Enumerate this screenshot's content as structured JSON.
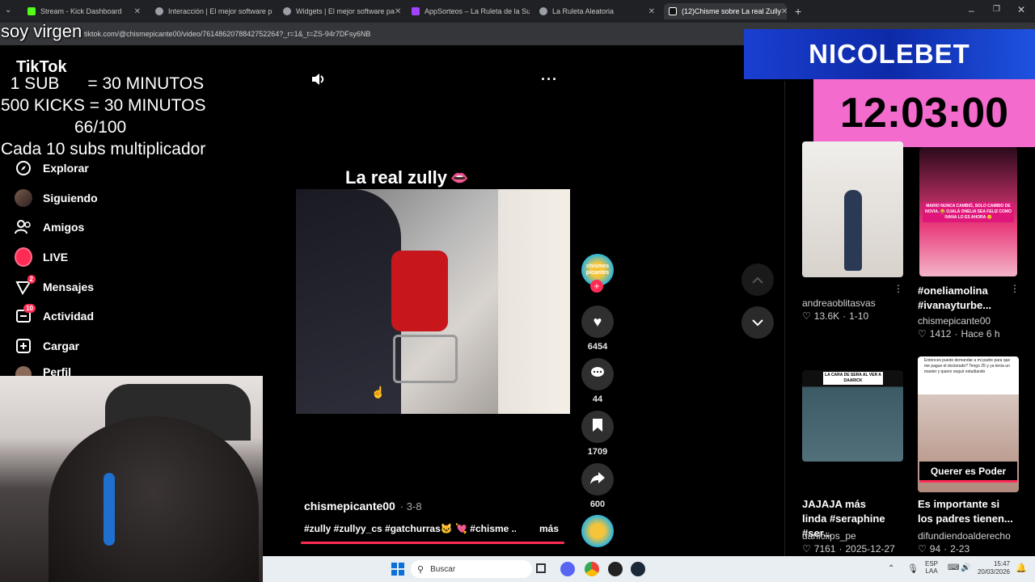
{
  "tabs": [
    {
      "label": "Stream - Kick Dashboard",
      "color": "#53fc18"
    },
    {
      "label": "Interacción | El mejor software p",
      "color": "#9aa0a6"
    },
    {
      "label": "Widgets | El mejor software pa",
      "color": "#9aa0a6"
    },
    {
      "label": "AppSorteos – La Ruleta de la Su",
      "color": "#a044ff"
    },
    {
      "label": "La Ruleta Aleatoria",
      "color": "#9aa0a6"
    },
    {
      "label": "(12)Chisme sobre La real Zully",
      "color": "#ffffff"
    }
  ],
  "url": "tiktok.com/@chismepicante00/video/7614862078842752264?_r=1&_t=ZS-94r7DFsy6NB",
  "overlay": {
    "soy_virgen": "soy virgen",
    "line1": "  1 SUB      = 30 MINUTOS",
    "line2": "500 KICKS = 30 MINUTOS",
    "line3": "66/100",
    "line4": "Cada 10 subs multiplicador",
    "brand": "NICOLEBET",
    "timer": "12:03:00"
  },
  "logo": "TikTok",
  "nav": [
    {
      "label": "Explorar",
      "icon": "compass-icon"
    },
    {
      "label": "Siguiendo",
      "icon": "following-avatar-icon"
    },
    {
      "label": "Amigos",
      "icon": "friends-icon"
    },
    {
      "label": "LIVE",
      "icon": "live-icon"
    },
    {
      "label": "Mensajes",
      "icon": "messages-icon",
      "badge": "2"
    },
    {
      "label": "Actividad",
      "icon": "activity-icon",
      "badge": "10"
    },
    {
      "label": "Cargar",
      "icon": "upload-icon"
    },
    {
      "label": "Perfil",
      "icon": "profile-icon"
    }
  ],
  "video": {
    "title": "La real zully",
    "author": "chismepicante00",
    "date": "3-8",
    "caption": "#zully #zullyy_cs #gatchurras🐱 💘 #chisme ...",
    "more": "más",
    "likes": "6454",
    "comments": "44",
    "saves": "1709",
    "shares": "600",
    "avatar_text": "chismes picantes"
  },
  "recommended": [
    {
      "title": "",
      "author": "andreaoblitasvas",
      "likes": "13.6K",
      "date": "1-10"
    },
    {
      "title": "#oneliamolina #ivanayturbe...",
      "author": "chismepicante00",
      "likes": "1412",
      "date": "Hace 6 h",
      "thumb_text": "MARIO NUNCA CAMBIÓ, SOLO CAMBIO DE NOVIA. 😂 OJALÁ ONELIA SEA FELIZ COMO IVANA LO ES AHORA 😌"
    },
    {
      "title": "JAJAJA más linda #seraphine #ser...",
      "author": "daniclips_pe",
      "likes": "7161",
      "date": "2025-12-27",
      "thumb_text": "LA CARA DE SERA AL VER A DAARICK"
    },
    {
      "title": "Es importante si los padres tienen...",
      "author": "difundiendoalderecho",
      "likes": "94",
      "date": "2-23",
      "thumb_text": "Entonces puedo demandar a mi padre para que me pague el doctorado? Tengo 25 y ya tenía un master y quiero seguir estudiando",
      "thumb_label": "Querer es Poder"
    }
  ],
  "taskbar": {
    "search": "Buscar",
    "lang1": "ESP",
    "lang2": "LAA",
    "time": "15:47",
    "date": "20/03/2026"
  }
}
